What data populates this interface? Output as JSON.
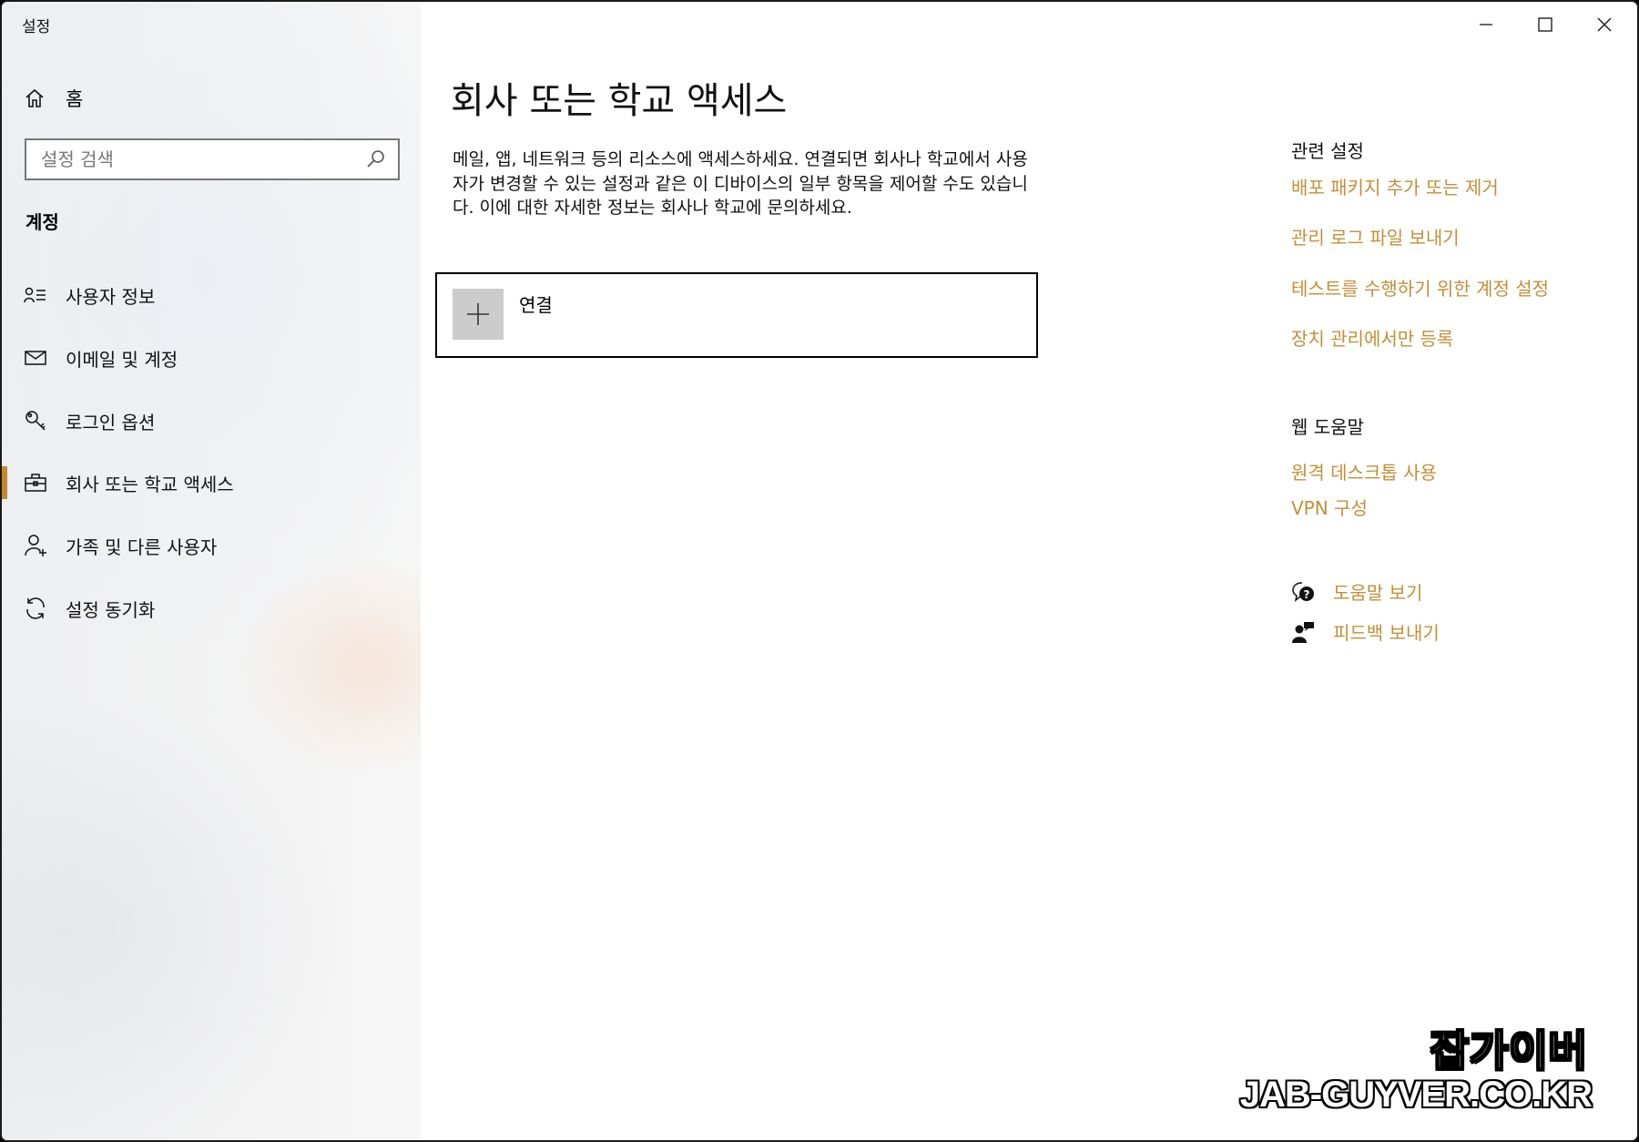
{
  "window": {
    "title": "설정",
    "controls": [
      "minimize",
      "maximize",
      "close"
    ]
  },
  "sidebar": {
    "home_label": "홈",
    "search_placeholder": "설정 검색",
    "section_label": "계정",
    "items": [
      {
        "label": "사용자 정보",
        "icon": "user-info-icon"
      },
      {
        "label": "이메일 및 계정",
        "icon": "mail-icon"
      },
      {
        "label": "로그인 옵션",
        "icon": "key-icon"
      },
      {
        "label": "회사 또는 학교 액세스",
        "icon": "briefcase-icon",
        "active": true
      },
      {
        "label": "가족 및 다른 사용자",
        "icon": "add-person-icon"
      },
      {
        "label": "설정 동기화",
        "icon": "sync-icon"
      }
    ]
  },
  "main": {
    "title": "회사 또는 학교 액세스",
    "description": "메일, 앱, 네트워크 등의 리소스에 액세스하세요. 연결되면 회사나 학교에서 사용자가 변경할 수 있는 설정과 같은 이 디바이스의 일부 항목을 제어할 수도 있습니다. 이에 대한 자세한 정보는 회사나 학교에 문의하세요.",
    "connect_label": "연결"
  },
  "right_panel": {
    "related_heading": "관련 설정",
    "related_links": [
      "배포 패키지 추가 또는 제거",
      "관리 로그 파일 보내기",
      "테스트를 수행하기 위한 계정 설정",
      "장치 관리에서만 등록"
    ],
    "web_help_heading": "웹 도움말",
    "web_help_links": [
      "원격 데스크톱 사용",
      "VPN 구성"
    ],
    "get_help": "도움말 보기",
    "give_feedback": "피드백 보내기"
  },
  "watermark": {
    "line1": "잡가이버",
    "line2": "JAB-GUYVER.CO.KR"
  },
  "colors": {
    "accent": "#c8872a",
    "link": "#c38f37",
    "connect_tile": "#cccccc"
  }
}
